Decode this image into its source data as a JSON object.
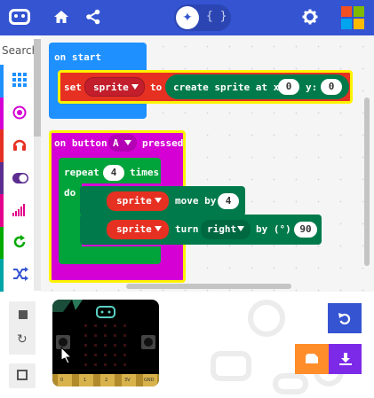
{
  "header": {
    "code_label": "{ }",
    "blocks_glyph": "✦",
    "colors": {
      "bar": "#3454D1",
      "ms_red": "#F25022",
      "ms_green": "#7FBA00",
      "ms_blue": "#00A4EF",
      "ms_yellow": "#FFB900"
    }
  },
  "toolbox": {
    "search_placeholder": "Search...",
    "categories": [
      {
        "name": "Basic",
        "icon": "grid-icon",
        "color": "#1E90FF"
      },
      {
        "name": "Input",
        "icon": "target-icon",
        "color": "#D400D4"
      },
      {
        "name": "Music",
        "icon": "headphones-icon",
        "color": "#E63022"
      },
      {
        "name": "Led",
        "icon": "toggle-icon",
        "color": "#5C2D91"
      },
      {
        "name": "Radio",
        "icon": "signal-icon",
        "color": "#E3008C"
      },
      {
        "name": "Loops",
        "icon": "loop-icon",
        "color": "#00AA00"
      },
      {
        "name": "Logic",
        "icon": "shuffle-icon",
        "color": "#00A4A6"
      }
    ]
  },
  "workspace": {
    "on_start": {
      "label": "on start",
      "set_label": "set",
      "var": "sprite",
      "to_label": "to",
      "create_label": "create sprite at x:",
      "x_value": "0",
      "y_label": "y:",
      "y_value": "0"
    },
    "on_button": {
      "label_1": "on button",
      "button": "A",
      "label_2": "pressed",
      "repeat_label": "repeat",
      "repeat_value": "4",
      "times_label": "times",
      "do_label": "do",
      "move_var": "sprite",
      "move_label": "move by",
      "move_value": "4",
      "turn_var": "sprite",
      "turn_label": "turn",
      "turn_dir": "right",
      "by_label": "by (°)",
      "turn_value": "90"
    }
  },
  "simulator": {
    "pins": [
      "0",
      "1",
      "2",
      "3V",
      "GND"
    ]
  }
}
